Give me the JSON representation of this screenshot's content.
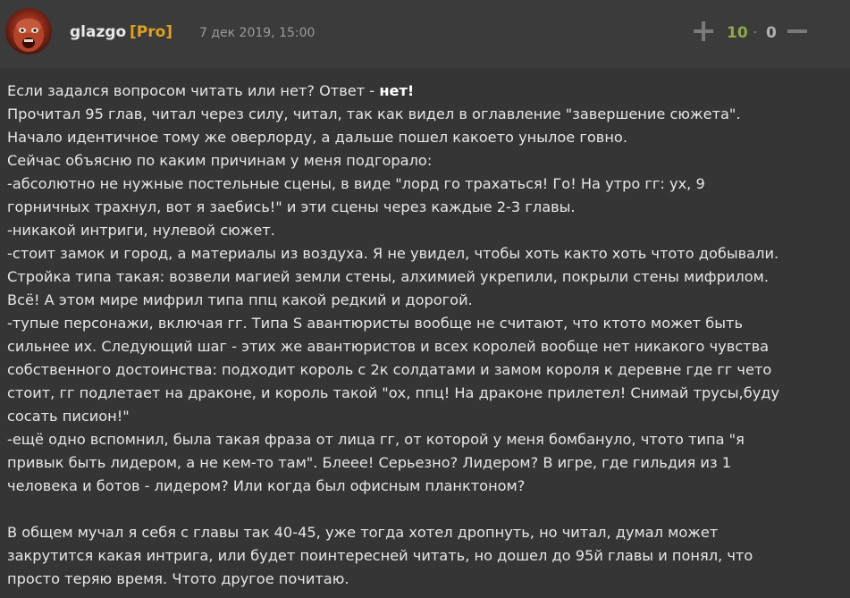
{
  "comment": {
    "author": "glazgo",
    "badge": "[Pro]",
    "timestamp": "7 дек 2019, 15:00",
    "score": {
      "plus": "10",
      "separator": "·",
      "minus": "0"
    },
    "paragraphs": [
      {
        "text": "Если задался вопросом читать или нет? Ответ - ",
        "bold": "нет!"
      },
      {
        "text": "Прочитал 95 глав, читал через силу, читал, так как видел в оглавление \"завершение сюжета\"."
      },
      {
        "text": "Начало идентичное тому же оверлорду, а дальше пошел какоето унылое говно."
      },
      {
        "text": "Сейчас объясню по каким причинам у меня подгорало:"
      },
      {
        "text": "-абсолютно не нужные постельные сцены, в виде \"лорд го трахаться! Го! На утро гг: ух, 9"
      },
      {
        "text": "горничных трахнул, вот я заебись!\" и эти сцены через каждые 2-3 главы."
      },
      {
        "text": "-никакой интриги, нулевой сюжет."
      },
      {
        "text": "-стоит замок и город, а материалы из воздуха. Я не увидел, чтобы хоть както хоть чтото добывали."
      },
      {
        "text": "Стройка типа такая: возвели магией земли стены, алхимией укрепили, покрыли стены мифрилом."
      },
      {
        "text": "Всё! А этом мире мифрил типа ппц какой редкий и дорогой."
      },
      {
        "text": "-тупые персонажи, включая гг. Типа S авантюристы вообще не считают, что ктото может быть"
      },
      {
        "text": "сильнее их. Следующий шаг - этих же авантюристов и всех королей вообще нет никакого чувства"
      },
      {
        "text": "собственного достоинства: подходит король с 2к солдатами и замом короля к деревне где гг чето"
      },
      {
        "text": "стоит, гг подлетает на драконе, и король такой \"ох, ппц! На драконе прилетел! Снимай трусы,буду"
      },
      {
        "text": "сосать писион!\""
      },
      {
        "text": "-ещё одно вспомнил, была такая фраза от лица гг, от которой у меня бомбануло, чтото типа \"я"
      },
      {
        "text": "привык быть лидером, а не кем-то там\". Блеее! Серьезно? Лидером? В игре, где гильдия из 1"
      },
      {
        "text": "человека и ботов - лидером? Или когда был офисным планктоном?"
      },
      {
        "text": ""
      },
      {
        "text": "В общем мучал я себя с главы так 40-45, уже тогда хотел дропнуть, но читал, думал может"
      },
      {
        "text": "закрутится какая интрига, или будет поинтересней читать, но дошел до 95й главы и понял, что"
      },
      {
        "text": "просто теряю время. Чтото другое почитаю."
      }
    ]
  },
  "colors": {
    "background": "#353535",
    "header": "#3b3b3b",
    "pro": "#e0a020",
    "score_plus": "#8fa84a"
  },
  "icons": {
    "upvote": "plus-icon",
    "downvote": "minus-icon"
  }
}
